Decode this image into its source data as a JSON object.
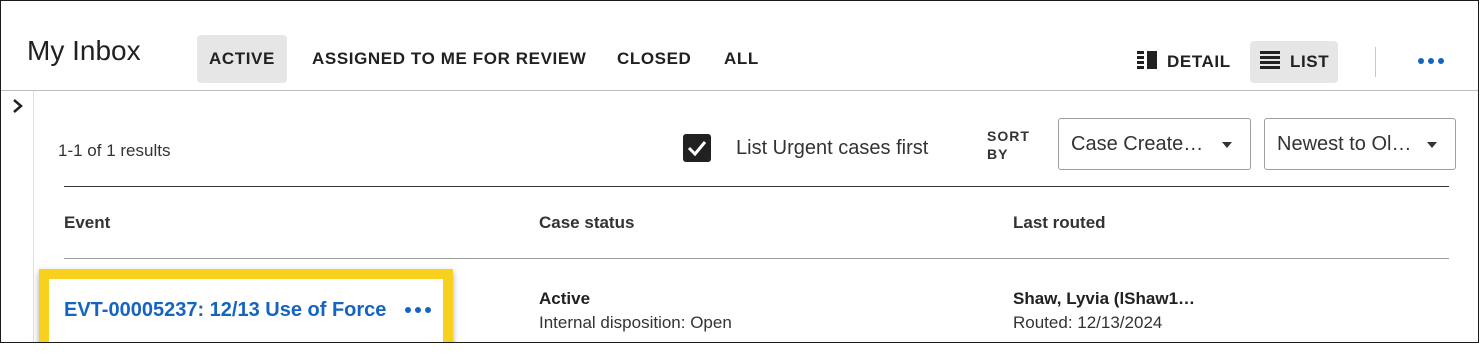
{
  "header": {
    "title": "My Inbox",
    "tabs": [
      {
        "label": "ACTIVE",
        "active": true
      },
      {
        "label": "ASSIGNED TO ME FOR REVIEW",
        "active": false
      },
      {
        "label": "CLOSED",
        "active": false
      },
      {
        "label": "ALL",
        "active": false
      }
    ],
    "views": [
      {
        "label": "DETAIL",
        "icon": "detail-view-icon",
        "active": false
      },
      {
        "label": "LIST",
        "icon": "list-view-icon",
        "active": true
      }
    ],
    "more_icon": "more-horizontal-icon"
  },
  "sidebar": {
    "expand_icon": "chevron-right-icon"
  },
  "toolbar": {
    "results_text": "1-1 of 1 results",
    "urgent_first": {
      "label": "List Urgent cases first",
      "checked": true
    },
    "sort_by_label": "SORT BY",
    "sort_field": "Case Create…",
    "sort_order": "Newest to Ol…"
  },
  "table": {
    "columns": [
      "Event",
      "Case status",
      "Last routed"
    ],
    "rows": [
      {
        "event": "EVT-00005237: 12/13 Use of Force",
        "status": "Active",
        "status_detail": "Internal disposition: Open",
        "routed_to": "Shaw, Lyvia (lShaw1…",
        "routed_date": "Routed: 12/13/2024"
      }
    ]
  },
  "colors": {
    "accent": "#1565c0",
    "highlight": "#f7d11d",
    "active_tab_bg": "#e6e6e6"
  }
}
